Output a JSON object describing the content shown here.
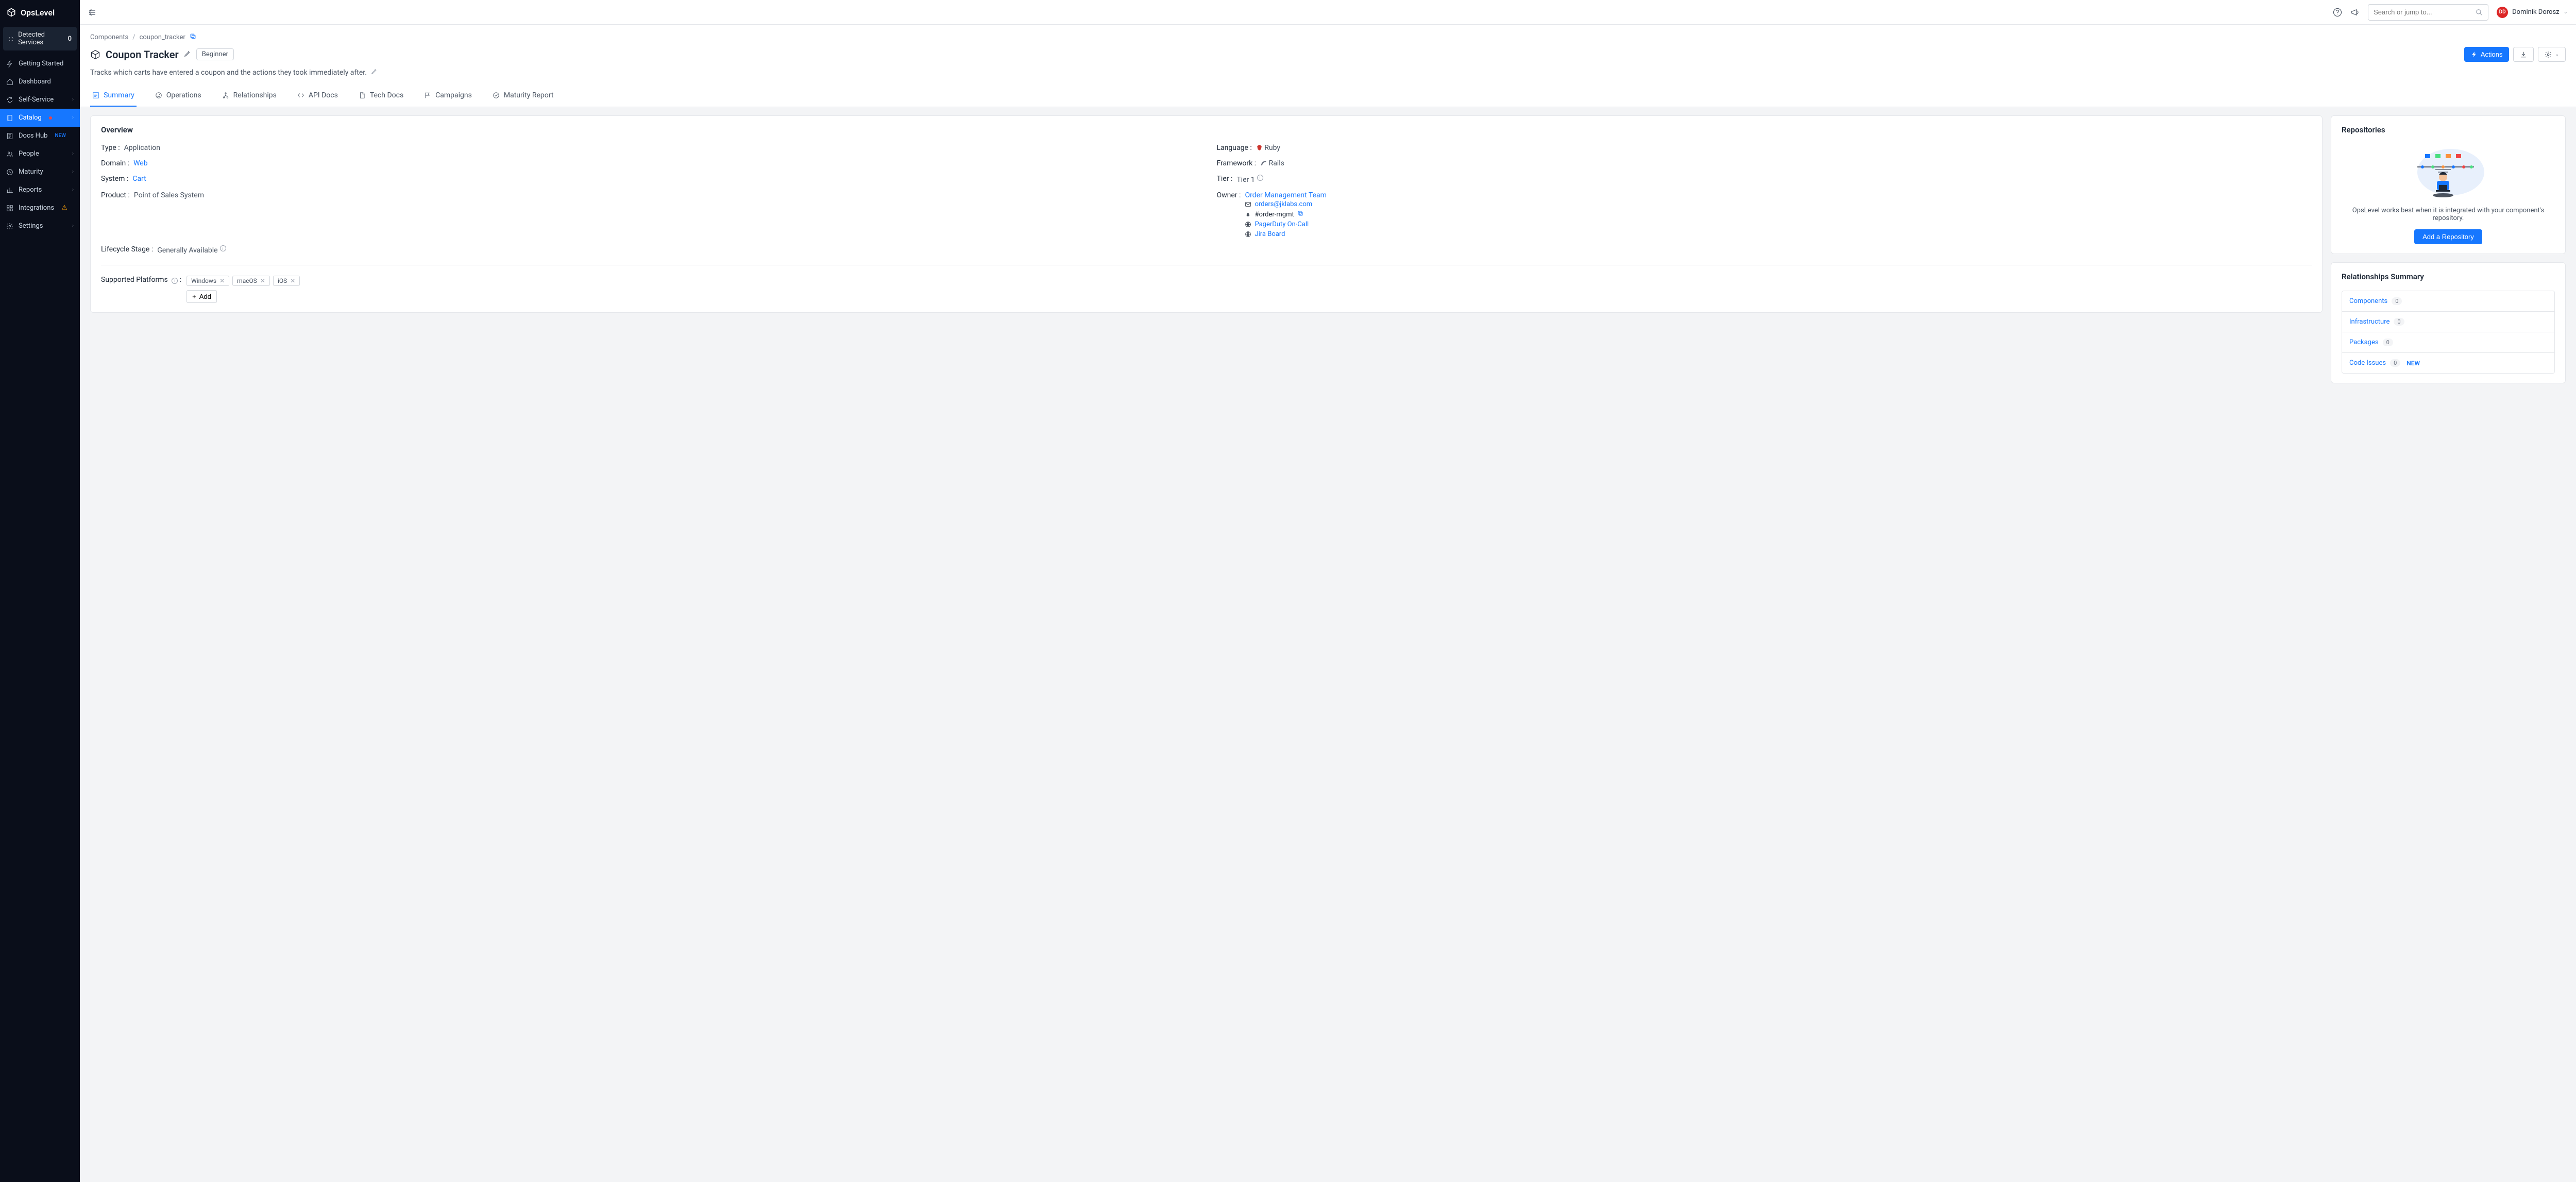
{
  "brand": "OpsLevel",
  "sidebar": {
    "detected": {
      "label": "Detected Services",
      "count": "0"
    },
    "items": [
      {
        "label": "Getting Started"
      },
      {
        "label": "Dashboard"
      },
      {
        "label": "Self-Service",
        "expandable": true
      },
      {
        "label": "Catalog",
        "expandable": true,
        "active": true,
        "dot": true
      },
      {
        "label": "Docs Hub",
        "badge": "NEW"
      },
      {
        "label": "People",
        "expandable": true
      },
      {
        "label": "Maturity",
        "expandable": true
      },
      {
        "label": "Reports",
        "expandable": true
      },
      {
        "label": "Integrations",
        "warn": true
      },
      {
        "label": "Settings",
        "expandable": true
      }
    ]
  },
  "topbar": {
    "search_placeholder": "Search or jump to...",
    "user_initials": "DD",
    "user_name": "Dominik Dorosz"
  },
  "breadcrumb": {
    "root": "Components",
    "current": "coupon_tracker"
  },
  "header": {
    "title": "Coupon Tracker",
    "level": "Beginner",
    "actions_label": "Actions",
    "description": "Tracks which carts have entered a coupon and the actions they took immediately after."
  },
  "tabs": [
    {
      "label": "Summary",
      "active": true
    },
    {
      "label": "Operations"
    },
    {
      "label": "Relationships"
    },
    {
      "label": "API Docs"
    },
    {
      "label": "Tech Docs"
    },
    {
      "label": "Campaigns"
    },
    {
      "label": "Maturity Report"
    }
  ],
  "overview": {
    "heading": "Overview",
    "type": {
      "label": "Type",
      "value": "Application"
    },
    "domain": {
      "label": "Domain",
      "value": "Web"
    },
    "system": {
      "label": "System",
      "value": "Cart"
    },
    "product": {
      "label": "Product",
      "value": "Point of Sales System"
    },
    "lifecycle": {
      "label": "Lifecycle Stage",
      "value": "Generally Available"
    },
    "language": {
      "label": "Language",
      "value": "Ruby"
    },
    "framework": {
      "label": "Framework",
      "value": "Rails"
    },
    "tier": {
      "label": "Tier",
      "value": "Tier 1"
    },
    "owner": {
      "label": "Owner",
      "team": "Order Management Team",
      "email": "orders@jklabs.com",
      "slack": "#order-mgmt",
      "pagerduty": "PagerDuty On-Call",
      "jira": "Jira Board"
    },
    "platforms": {
      "label": "Supported Platforms",
      "items": [
        "Windows",
        "macOS",
        "iOS"
      ],
      "add": "Add"
    }
  },
  "repos": {
    "heading": "Repositories",
    "text": "OpsLevel works best when it is integrated with your component's repository.",
    "button": "Add a Repository"
  },
  "relationships": {
    "heading": "Relationships Summary",
    "items": [
      {
        "name": "Components",
        "count": "0"
      },
      {
        "name": "Infrastructure",
        "count": "0"
      },
      {
        "name": "Packages",
        "count": "0"
      },
      {
        "name": "Code Issues",
        "count": "0",
        "new": "NEW"
      }
    ]
  }
}
